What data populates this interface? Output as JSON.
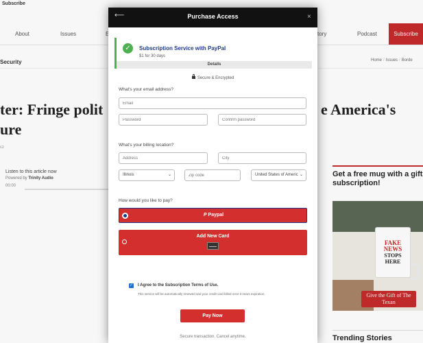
{
  "topbar": {
    "subscribe": "Subscribe"
  },
  "nav": {
    "about": "About",
    "issues": "Issues",
    "cut_left": "E",
    "history": "tory",
    "podcast": "Podcast",
    "subscribe": "Subscribe"
  },
  "section": {
    "title": "Security",
    "breadcrumb": [
      "Home",
      "Issues",
      "Borde"
    ]
  },
  "article": {
    "headline_left_1": "ter: Fringe polit",
    "headline_right_1": "e America's",
    "headline_left_2": "ure",
    "byline": "cz",
    "audio_title": "Listen to this article now",
    "audio_powered_prefix": "Powered by",
    "audio_powered_brand": "Trinity Audio",
    "audio_time": "00:00"
  },
  "promo": {
    "title": "Get a free mug with a gift subscription!",
    "mug_line1": "FAKE",
    "mug_line2": "NEWS",
    "mug_line3": "STOPS",
    "mug_line4": "HERE",
    "gift_button": "Give the Gift of The Texan"
  },
  "trending": {
    "title": "Trending Stories"
  },
  "modal": {
    "back": "⟵",
    "title": "Purchase Access",
    "close": "×",
    "plan": {
      "check": "✓",
      "name": "Subscription Service with PayPal",
      "price": "$1 for 30 days",
      "details": "Details"
    },
    "secure": "Secure & Encrypted",
    "email_question": "What's your email address?",
    "email_placeholder": "Email",
    "password_placeholder": "Password",
    "confirm_placeholder": "Confirm password",
    "billing_question": "What's your billing location?",
    "address_placeholder": "Address",
    "city_placeholder": "City",
    "state_value": "Illinois",
    "zip_placeholder": "Zip code",
    "country_value": "United States of America",
    "pay_question": "How would you like to pay?",
    "paypal_icon": "P",
    "paypal_label": "Paypal",
    "card_label": "Add New Card",
    "agree_check": "✓",
    "agree_text": "I Agree to the Subscription Terms of Use.",
    "agree_note": "This service will be automatically renewed and your credit card billed once it nears expiration.",
    "pay_now": "Pay Now",
    "footer_note": "Secure transaction. Cancel anytime."
  },
  "colors": {
    "accent_red": "#d32f2f",
    "success_green": "#4caf50",
    "plan_blue": "#1d3a8a",
    "header_black": "#111111"
  }
}
